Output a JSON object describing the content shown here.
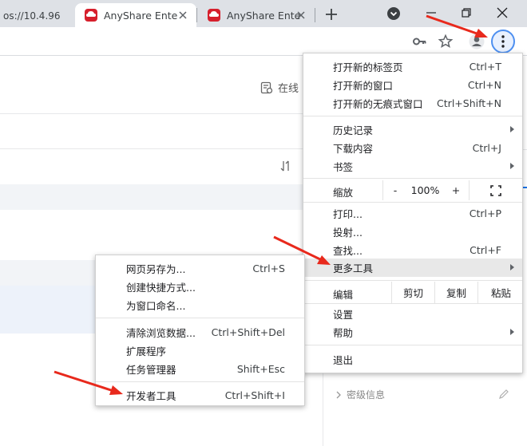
{
  "tabs": {
    "partial_title": "os://10.4.96",
    "items": [
      {
        "title": "AnyShare Ente",
        "active": true
      },
      {
        "title": "AnyShare Ente",
        "active": false
      }
    ]
  },
  "page": {
    "online_label": "在线",
    "secret_label": "密级信息"
  },
  "menu": {
    "new_tab": "打开新的标签页",
    "new_tab_sc": "Ctrl+T",
    "new_window": "打开新的窗口",
    "new_window_sc": "Ctrl+N",
    "incognito": "打开新的无痕式窗口",
    "incognito_sc": "Ctrl+Shift+N",
    "history": "历史记录",
    "downloads": "下载内容",
    "downloads_sc": "Ctrl+J",
    "bookmarks": "书签",
    "zoom": "缩放",
    "zoom_minus": "-",
    "zoom_value": "100%",
    "zoom_plus": "+",
    "print": "打印...",
    "print_sc": "Ctrl+P",
    "cast": "投射...",
    "find": "查找...",
    "find_sc": "Ctrl+F",
    "more_tools": "更多工具",
    "edit": "编辑",
    "cut": "剪切",
    "copy": "复制",
    "paste": "粘贴",
    "settings": "设置",
    "help": "帮助",
    "exit": "退出"
  },
  "submenu": {
    "save_as": "网页另存为...",
    "save_as_sc": "Ctrl+S",
    "shortcut": "创建快捷方式...",
    "name_window": "为窗口命名...",
    "clear_data": "清除浏览数据...",
    "clear_data_sc": "Ctrl+Shift+Del",
    "extensions": "扩展程序",
    "task_manager": "任务管理器",
    "task_manager_sc": "Shift+Esc",
    "devtools": "开发者工具",
    "devtools_sc": "Ctrl+Shift+I"
  },
  "colors": {
    "accent": "#1a73e8",
    "arrow": "#e8291c",
    "favicon": "#d61f2c"
  }
}
